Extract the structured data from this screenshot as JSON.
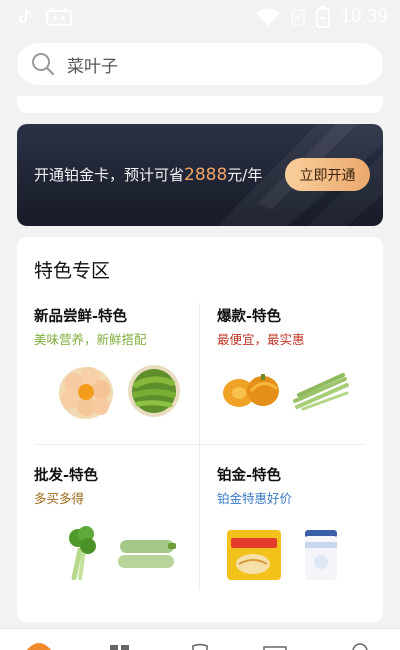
{
  "status_bar": {
    "time": "10:39"
  },
  "search": {
    "placeholder": "菜叶子"
  },
  "banner": {
    "text_prefix": "开通铂金卡，预计可省",
    "amount": "2888",
    "text_suffix": "元/年",
    "button_label": "立即开通"
  },
  "section": {
    "title": "特色专区",
    "cells": [
      {
        "title": "新品尝鲜-特色",
        "subtitle": "美味营养，新鲜搭配",
        "subtitle_color": "#7fae3d",
        "images": [
          "eggs-image",
          "green-beans-image"
        ]
      },
      {
        "title": "爆款-特色",
        "subtitle": "最便宜，最实惠",
        "subtitle_color": "#c0392b",
        "images": [
          "pumpkin-image",
          "long-beans-image"
        ]
      },
      {
        "title": "批发-特色",
        "subtitle": "多买多得",
        "subtitle_color": "#a06a1a",
        "images": [
          "celery-image",
          "zucchini-image"
        ]
      },
      {
        "title": "铂金-特色",
        "subtitle": "铂金特惠好价",
        "subtitle_color": "#3d7cc9",
        "images": [
          "noodle-pack-image",
          "milk-powder-image"
        ]
      }
    ]
  },
  "colors": {
    "accent": "#f0a46a",
    "banner_bg": "#1c2130"
  }
}
